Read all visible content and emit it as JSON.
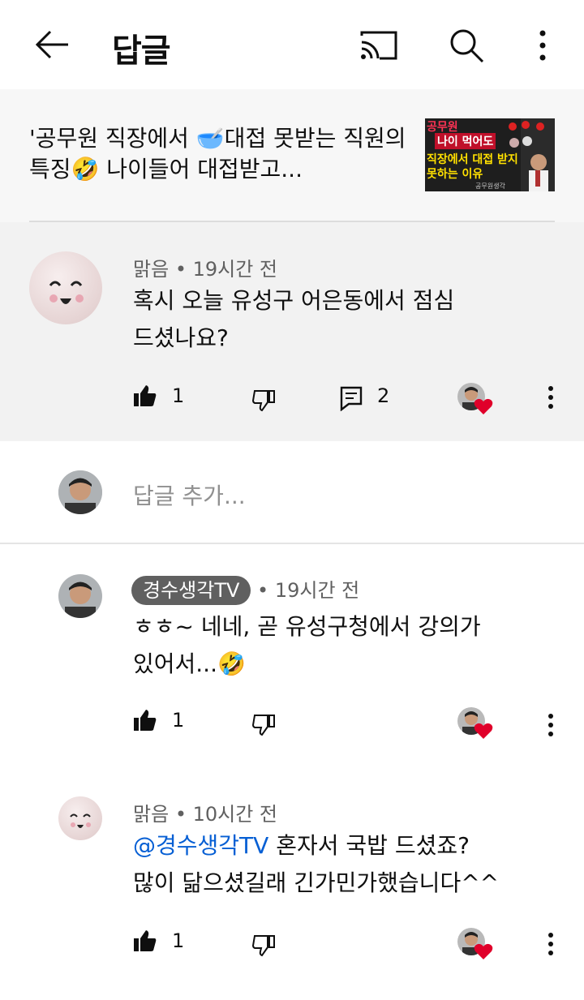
{
  "header": {
    "title": "답글",
    "icons": [
      "back-arrow-icon",
      "cast-icon",
      "search-icon",
      "more-vertical-icon"
    ]
  },
  "video": {
    "title": "'공무원 직장에서 🥣대접 못받는 직원의 특징🤣 나이들어 대접받고...",
    "thumbnail": {
      "line1": "공무원",
      "line2": "나이 먹어도",
      "line3": "직장에서 대접 받지",
      "line4": "못하는 이유",
      "caption": "공무원생각"
    }
  },
  "parent_comment": {
    "author": "맑음",
    "time": "• 19시간 전",
    "text_line1": "혹시 오늘 유성구 어은동에서 점심",
    "text_line2": "드셨나요?",
    "likes": "1",
    "replies": "2"
  },
  "add_reply": {
    "placeholder": "답글 추가..."
  },
  "replies": [
    {
      "author": "경수생각TV",
      "time": "• 19시간 전",
      "text_line1": "ㅎㅎ~ 네네, 곧 유성구청에서 강의가",
      "text_line2": "있어서...🤣",
      "likes": "1"
    },
    {
      "author": "맑음",
      "time": "• 10시간 전",
      "mention": "@경수생각TV",
      "text_line1_rest": " 혼자서 국밥 드셨죠?",
      "text_line2": "많이 닮으셨길래 긴가민가했습니다^^",
      "likes": "1"
    }
  ],
  "colors": {
    "accent_link": "#065fd4",
    "heart": "#e0002a",
    "chip_bg": "#606060"
  }
}
